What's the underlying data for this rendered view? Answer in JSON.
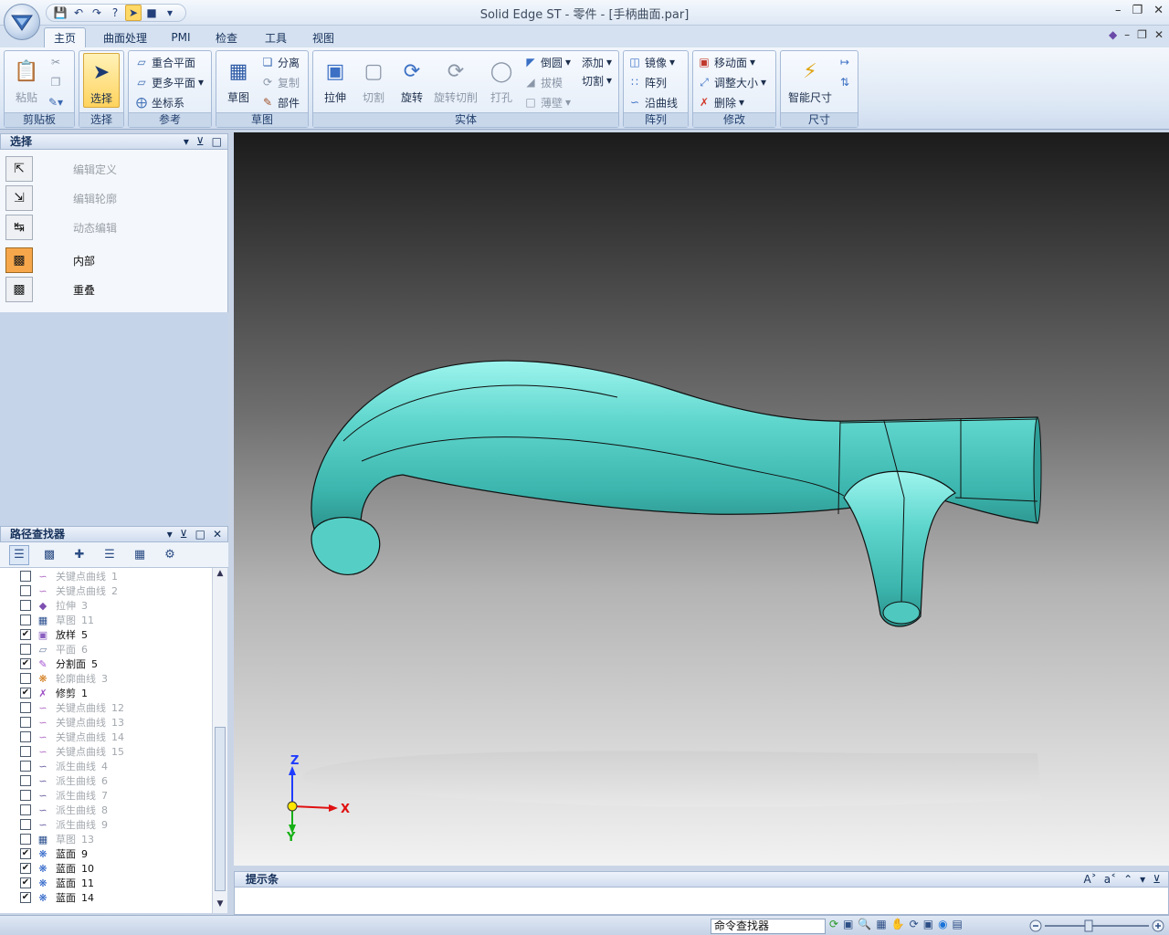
{
  "window": {
    "title": "Solid Edge ST - 零件 - [手柄曲面.par]"
  },
  "tabs": [
    {
      "label": "主页",
      "active": true
    },
    {
      "label": "曲面处理",
      "active": false
    },
    {
      "label": "PMI",
      "active": false
    },
    {
      "label": "检查",
      "active": false
    },
    {
      "label": "工具",
      "active": false
    },
    {
      "label": "视图",
      "active": false
    }
  ],
  "ribbon": {
    "clipboard": {
      "label": "剪贴板",
      "paste": "粘贴"
    },
    "select": {
      "label": "选择",
      "select": "选择"
    },
    "reference": {
      "label": "参考",
      "coincident_plane": "重合平面",
      "more_planes": "更多平面",
      "coordinate_system": "坐标系"
    },
    "sketch": {
      "label": "草图",
      "sketch": "草图",
      "separate": "分离",
      "copy": "复制",
      "part": "部件"
    },
    "solid": {
      "label": "实体",
      "extrude": "拉伸",
      "cut": "切割",
      "revolve": "旋转",
      "revolve_cut": "旋转切削",
      "hole": "打孔",
      "round": "倒圆",
      "draft": "拔模",
      "thin_wall": "薄壁",
      "add": "添加",
      "cut_menu": "切割"
    },
    "pattern": {
      "label": "阵列",
      "mirror": "镜像",
      "array": "阵列",
      "along_curve": "沿曲线"
    },
    "modify": {
      "label": "修改",
      "move_face": "移动面",
      "resize": "调整大小",
      "delete": "删除"
    },
    "dimension": {
      "label": "尺寸",
      "smart_dimension": "智能尺寸"
    }
  },
  "select_panel": {
    "title": "选择",
    "items": [
      {
        "label": "编辑定义",
        "enabled": false
      },
      {
        "label": "编辑轮廓",
        "enabled": false
      },
      {
        "label": "动态编辑",
        "enabled": false
      },
      {
        "label": "内部",
        "enabled": true
      },
      {
        "label": "重叠",
        "enabled": true
      }
    ]
  },
  "pathfinder": {
    "title": "路径查找器",
    "items": [
      {
        "name": "关键点曲线",
        "num": "1",
        "checked": false,
        "icon": "keypoint-curve-icon"
      },
      {
        "name": "关键点曲线",
        "num": "2",
        "checked": false,
        "icon": "keypoint-curve-icon"
      },
      {
        "name": "拉伸",
        "num": "3",
        "checked": false,
        "icon": "extrude-surface-icon"
      },
      {
        "name": "草图",
        "num": "11",
        "checked": false,
        "icon": "sketch-icon"
      },
      {
        "name": "放样",
        "num": "5",
        "checked": true,
        "icon": "loft-icon"
      },
      {
        "name": "平面",
        "num": "6",
        "checked": false,
        "icon": "plane-icon"
      },
      {
        "name": "分割面",
        "num": "5",
        "checked": true,
        "icon": "split-face-icon"
      },
      {
        "name": "轮廓曲线",
        "num": "3",
        "checked": false,
        "icon": "contour-curve-icon"
      },
      {
        "name": "修剪",
        "num": "1",
        "checked": true,
        "icon": "trim-icon"
      },
      {
        "name": "关键点曲线",
        "num": "12",
        "checked": false,
        "icon": "keypoint-curve-icon"
      },
      {
        "name": "关键点曲线",
        "num": "13",
        "checked": false,
        "icon": "keypoint-curve-icon"
      },
      {
        "name": "关键点曲线",
        "num": "14",
        "checked": false,
        "icon": "keypoint-curve-icon"
      },
      {
        "name": "关键点曲线",
        "num": "15",
        "checked": false,
        "icon": "keypoint-curve-icon"
      },
      {
        "name": "派生曲线",
        "num": "4",
        "checked": false,
        "icon": "derived-curve-icon"
      },
      {
        "name": "派生曲线",
        "num": "6",
        "checked": false,
        "icon": "derived-curve-icon"
      },
      {
        "name": "派生曲线",
        "num": "7",
        "checked": false,
        "icon": "derived-curve-icon"
      },
      {
        "name": "派生曲线",
        "num": "8",
        "checked": false,
        "icon": "derived-curve-icon"
      },
      {
        "name": "派生曲线",
        "num": "9",
        "checked": false,
        "icon": "derived-curve-icon"
      },
      {
        "name": "草图",
        "num": "13",
        "checked": false,
        "icon": "sketch-icon"
      },
      {
        "name": "蓝面",
        "num": "9",
        "checked": true,
        "icon": "bluesurf-icon"
      },
      {
        "name": "蓝面",
        "num": "10",
        "checked": true,
        "icon": "bluesurf-icon"
      },
      {
        "name": "蓝面",
        "num": "11",
        "checked": true,
        "icon": "bluesurf-icon"
      },
      {
        "name": "蓝面",
        "num": "14",
        "checked": true,
        "icon": "bluesurf-icon"
      }
    ]
  },
  "viewport": {
    "triad": {
      "x": "X",
      "y": "Y",
      "z": "Z"
    },
    "model_color": "#53cbc3"
  },
  "prompt_bar": {
    "title": "提示条"
  },
  "status_bar": {
    "command_finder": "命令查找器"
  }
}
